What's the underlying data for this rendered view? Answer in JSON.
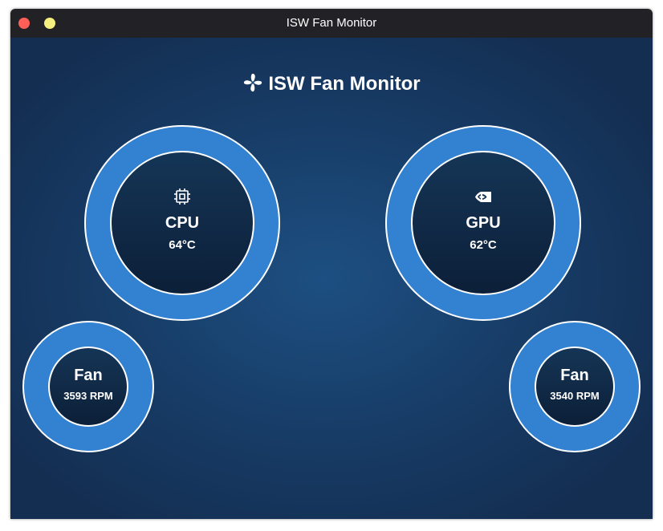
{
  "window": {
    "title": "ISW Fan Monitor"
  },
  "header": {
    "title": "ISW Fan Monitor",
    "icon": "fan-icon"
  },
  "gauges": {
    "cpu": {
      "label": "CPU",
      "value": "64°C",
      "icon": "cpu-chip-icon"
    },
    "gpu": {
      "label": "GPU",
      "value": "62°C",
      "icon": "nvidia-logo-icon"
    },
    "fan_left": {
      "label": "Fan",
      "value": "3593 RPM"
    },
    "fan_right": {
      "label": "Fan",
      "value": "3540 RPM"
    }
  },
  "colors": {
    "titlebar": "#222226",
    "background": "#1d4f82",
    "ring": "#3381d1",
    "inner": "#0c1f38",
    "close": "#ff5f57",
    "minimize": "#f5f07e"
  }
}
